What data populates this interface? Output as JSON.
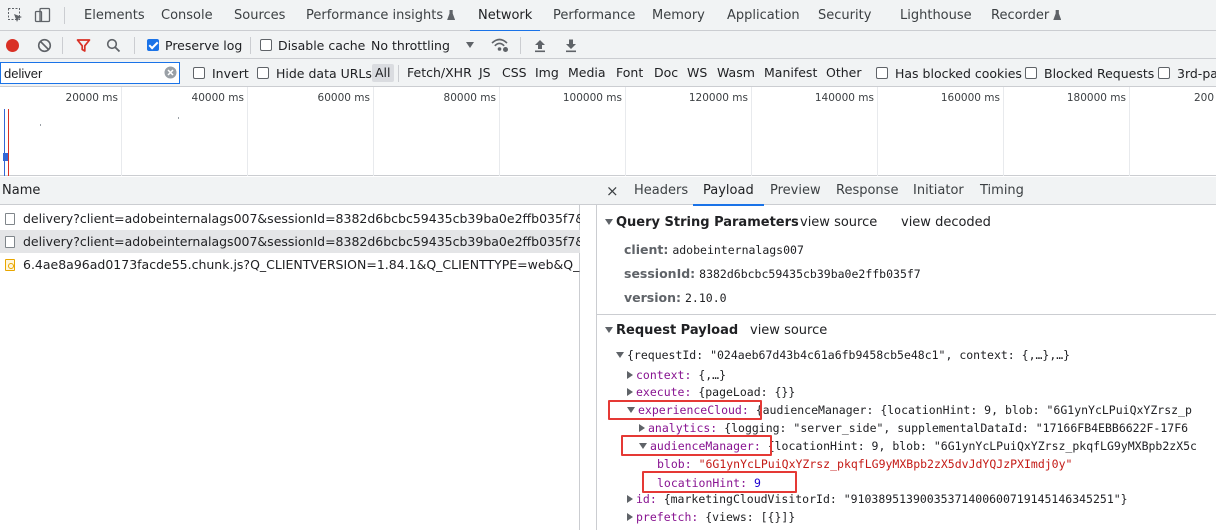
{
  "tabs": {
    "items": [
      "Elements",
      "Console",
      "Sources",
      "Performance insights",
      "Network",
      "Performance",
      "Memory",
      "Application",
      "Security",
      "Lighthouse",
      "Recorder"
    ],
    "active": "Network"
  },
  "toolbar": {
    "preserve_log": "Preserve log",
    "disable_cache": "Disable cache",
    "throttling": "No throttling"
  },
  "filter": {
    "value": "deliver",
    "invert": "Invert",
    "hide_data_urls": "Hide data URLs",
    "types": [
      "All",
      "Fetch/XHR",
      "JS",
      "CSS",
      "Img",
      "Media",
      "Font",
      "Doc",
      "WS",
      "Wasm",
      "Manifest",
      "Other"
    ],
    "has_blocked_cookies": "Has blocked cookies",
    "blocked_requests": "Blocked Requests",
    "third_party": "3rd-pa"
  },
  "overview": {
    "ticks": [
      "20000 ms",
      "40000 ms",
      "60000 ms",
      "80000 ms",
      "100000 ms",
      "120000 ms",
      "140000 ms",
      "160000 ms",
      "180000 ms",
      "200"
    ]
  },
  "list": {
    "header": "Name",
    "requests": [
      "delivery?client=adobeinternalags007&sessionId=8382d6bcbc59435cb39ba0e2ffb035f7&vers...",
      "delivery?client=adobeinternalags007&sessionId=8382d6bcbc59435cb39ba0e2ffb035f7&vers...",
      "6.4ae8a96ad0173facde55.chunk.js?Q_CLIENTVERSION=1.84.1&Q_CLIENTTYPE=web&Q_BRA..."
    ]
  },
  "detail": {
    "close": "×",
    "tabs": [
      "Headers",
      "Payload",
      "Preview",
      "Response",
      "Initiator",
      "Timing"
    ],
    "active_tab": "Payload",
    "query": {
      "title": "Query String Parameters",
      "view_source": "view source",
      "view_decoded": "view decoded",
      "params": [
        {
          "k": "client:",
          "v": "adobeinternalags007"
        },
        {
          "k": "sessionId:",
          "v": "8382d6bcbc59435cb39ba0e2ffb035f7"
        },
        {
          "k": "version:",
          "v": "2.10.0"
        }
      ]
    },
    "payload": {
      "title": "Request Payload",
      "view_source": "view source",
      "l0": "{requestId: \"024aeb67d43b4c61a6fb9458cb5e48c1\", context: {,…},…}",
      "l1k": "context:",
      "l1v": " {,…}",
      "l2k": "execute:",
      "l2v": " {pageLoad: {}}",
      "l3k": "experienceCloud:",
      "l3v": " {audienceManager: {locationHint: 9, blob: \"6G1ynYcLPuiQxYZrsz_p",
      "l4k": "analytics:",
      "l4v": " {logging: \"server_side\", supplementalDataId: \"17166FB4EBB6622F-17F6",
      "l5k": "audienceManager:",
      "l5v": " {locationHint: 9, blob: \"6G1ynYcLPuiQxYZrsz_pkqfLG9yMXBpb2zX5c",
      "l6k": "blob:",
      "l6v": "\"6G1ynYcLPuiQxYZrsz_pkqfLG9yMXBpb2zX5dvJdYQJzPXImdj0y\"",
      "l7k": "locationHint:",
      "l7v": "9",
      "l8k": "id:",
      "l8v": " {marketingCloudVisitorId: \"91038951390035371400600719145146345251\"}",
      "l9k": "prefetch:",
      "l9v": " {views: [{}]}"
    }
  }
}
